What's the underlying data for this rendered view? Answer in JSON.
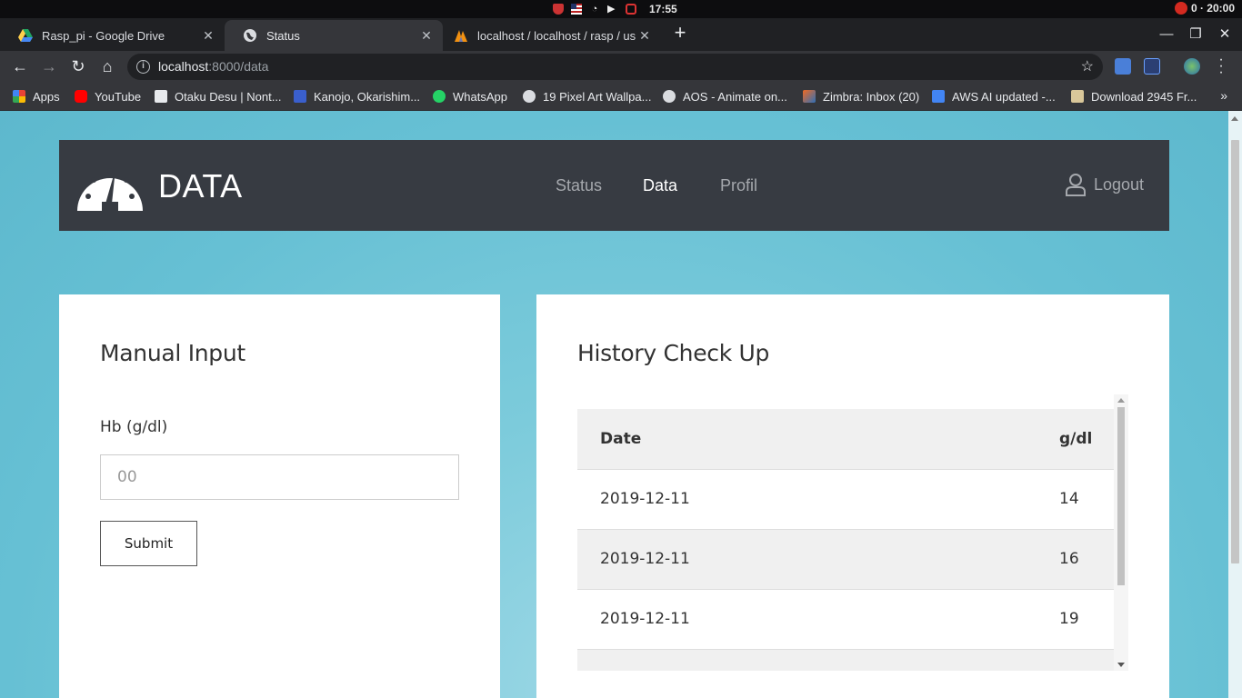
{
  "os": {
    "clock": "17:55",
    "pomodoro": "0 · 20:00",
    "icons": [
      "shield-icon",
      "us-flag-icon",
      "wifi-icon",
      "volume-icon",
      "alert-icon"
    ]
  },
  "tabs": [
    {
      "title": "Rasp_pi - Google Drive",
      "icon": "google-drive-icon",
      "active": false
    },
    {
      "title": "Status",
      "icon": "globe-icon",
      "active": true
    },
    {
      "title": "localhost / localhost / rasp / use",
      "icon": "phpmyadmin-icon",
      "active": false
    }
  ],
  "toolbar": {
    "url_host": "localhost",
    "url_path": ":8000/data",
    "star_icon": "star-icon"
  },
  "bookmarks": [
    {
      "label": "Apps",
      "icon": "apps-grid-icon"
    },
    {
      "label": "YouTube",
      "icon": "youtube-icon"
    },
    {
      "label": "Otaku Desu | Nont...",
      "icon": "otakudesu-icon"
    },
    {
      "label": "Kanojo, Okarishim...",
      "icon": "kc-icon"
    },
    {
      "label": "WhatsApp",
      "icon": "whatsapp-icon"
    },
    {
      "label": "19 Pixel Art Wallpa...",
      "icon": "globe-icon"
    },
    {
      "label": "AOS - Animate on...",
      "icon": "globe-icon"
    },
    {
      "label": "Zimbra: Inbox (20)",
      "icon": "zimbra-icon"
    },
    {
      "label": "AWS AI updated -...",
      "icon": "docs-icon"
    },
    {
      "label": "Download 2945 Fr...",
      "icon": "download-site-icon"
    }
  ],
  "app": {
    "brand": "DATA",
    "nav": [
      {
        "label": "Status",
        "active": false
      },
      {
        "label": "Data",
        "active": true
      },
      {
        "label": "Profil",
        "active": false
      }
    ],
    "logout_label": "Logout"
  },
  "manual_input": {
    "title": "Manual Input",
    "field_label": "Hb (g/dl)",
    "field_placeholder": "00",
    "field_value": "",
    "submit_label": "Submit"
  },
  "history": {
    "title": "History Check Up",
    "columns": [
      "Date",
      "g/dl"
    ],
    "rows": [
      {
        "date": "2019-12-11",
        "value": "14"
      },
      {
        "date": "2019-12-11",
        "value": "16"
      },
      {
        "date": "2019-12-11",
        "value": "19"
      },
      {
        "date": "",
        "value": ""
      }
    ]
  }
}
